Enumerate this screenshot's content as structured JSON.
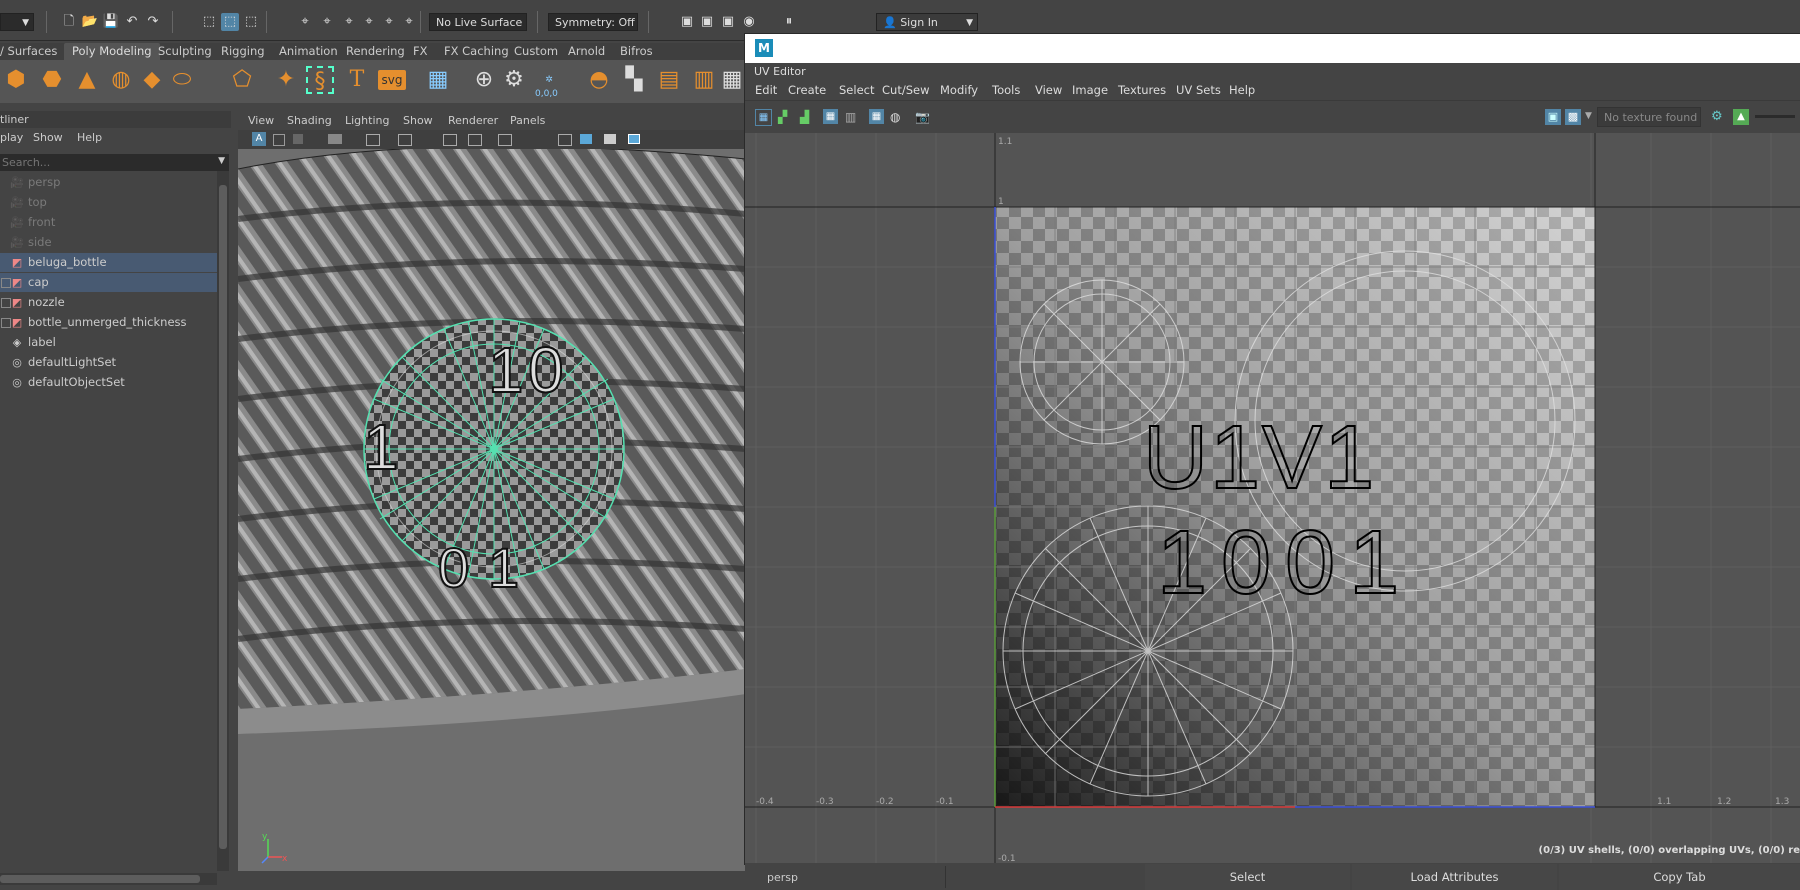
{
  "status_line": {
    "live_surface": "No Live Surface",
    "symmetry": "Symmetry: Off",
    "sign_in": "Sign In"
  },
  "shelf": {
    "tabs": [
      "/ Surfaces",
      "Poly Modeling",
      "Sculpting",
      "Rigging",
      "Animation",
      "Rendering",
      "FX",
      "FX Caching",
      "Custom",
      "Arnold",
      "Bifros"
    ],
    "active_tab": "Poly Modeling",
    "svg_label": "svg",
    "text_label": "T",
    "coords_label": "0,0,0"
  },
  "outliner": {
    "title": "tliner",
    "menu": [
      "play",
      "Show",
      "Help"
    ],
    "search_placeholder": "Search...",
    "items": [
      {
        "label": "persp",
        "dim": true,
        "icon": "camera-icon"
      },
      {
        "label": "top",
        "dim": true,
        "icon": "camera-icon"
      },
      {
        "label": "front",
        "dim": true,
        "icon": "camera-icon"
      },
      {
        "label": "side",
        "dim": true,
        "icon": "camera-icon"
      },
      {
        "label": "beluga_bottle",
        "selected": true,
        "icon": "mesh-icon"
      },
      {
        "label": "cap",
        "selected": true,
        "icon": "mesh-icon",
        "expander": "+"
      },
      {
        "label": "nozzle",
        "icon": "mesh-icon",
        "expander": "+"
      },
      {
        "label": "bottle_unmerged_thickness",
        "icon": "mesh-icon",
        "expander": "+"
      },
      {
        "label": "label",
        "icon": "group-icon",
        "expander": "•"
      },
      {
        "label": "defaultLightSet",
        "icon": "set-icon"
      },
      {
        "label": "defaultObjectSet",
        "icon": "set-icon"
      }
    ]
  },
  "viewport": {
    "menu": [
      "View",
      "Shading",
      "Lighting",
      "Show",
      "Renderer",
      "Panels"
    ],
    "camera_label": "persp"
  },
  "uv_editor": {
    "title": "UV Editor",
    "menu": [
      "Edit",
      "Create",
      "Select",
      "Cut/Sew",
      "Modify",
      "Tools",
      "View",
      "Image",
      "Textures",
      "UV Sets",
      "Help"
    ],
    "texture_dropdown": "No texture found",
    "tile_label_line1": "U1V1",
    "tile_label_line2": "1001",
    "x_ticks": [
      "-0.4",
      "-0.3",
      "-0.2",
      "-0.1",
      "1.1",
      "1.2",
      "1.3"
    ],
    "y_ticks": [
      "1.1",
      "1",
      "-0.1"
    ],
    "status": "(0/3) UV shells, (0/0) overlapping UVs, (0/0) re"
  },
  "bottom_bar": {
    "buttons": [
      "Select",
      "Load Attributes",
      "Copy Tab"
    ]
  },
  "colors": {
    "accent_blue": "#5285a6",
    "selection_row": "#485a72",
    "uv_wireframe_green": "#55e0b0"
  }
}
